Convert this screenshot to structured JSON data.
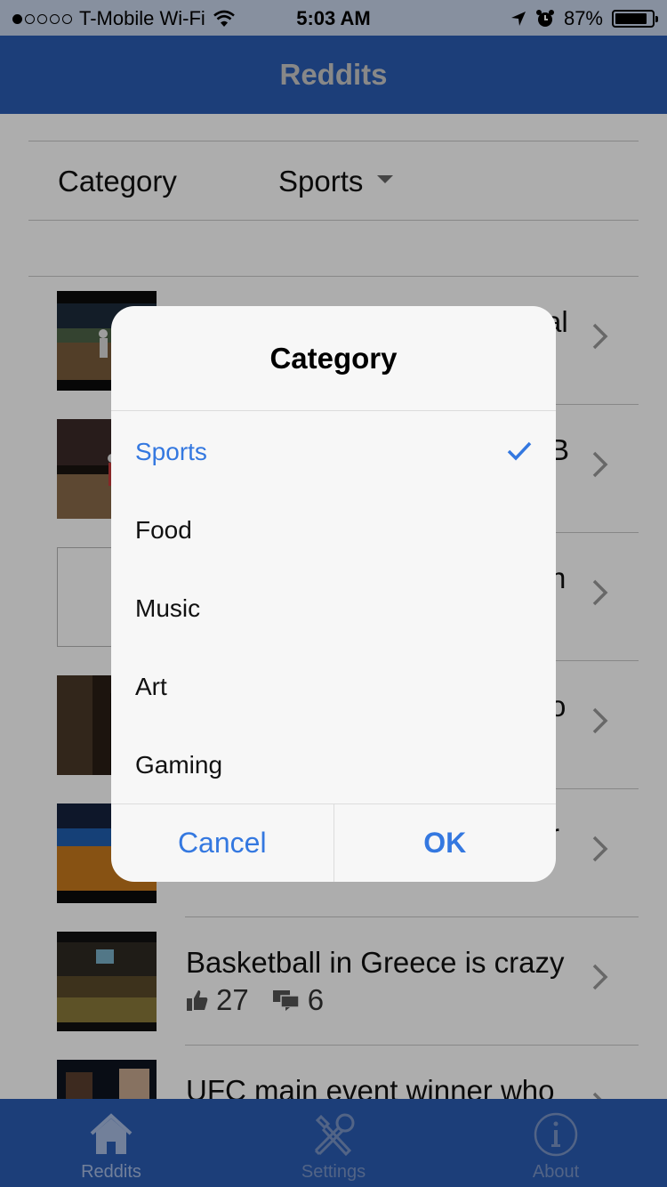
{
  "status_bar": {
    "carrier": "T-Mobile Wi-Fi",
    "time": "5:03 AM",
    "battery": "87%",
    "battery_level": 0.87,
    "signal_bars_filled": 1
  },
  "nav": {
    "title": "Reddits"
  },
  "filter": {
    "label": "Category",
    "value": "Sports"
  },
  "list": {
    "rows": [
      {
        "title": "",
        "likes": "",
        "comments": ""
      },
      {
        "title": "",
        "likes": "",
        "comments": ""
      },
      {
        "title": "",
        "likes": "",
        "comments": ""
      },
      {
        "title": "",
        "likes": "",
        "comments": ""
      },
      {
        "title": "",
        "likes": "",
        "comments": ""
      },
      {
        "title": "Basketball in Greece is crazy",
        "likes": "27",
        "comments": "6"
      },
      {
        "title": "UFC main event winner who",
        "likes": "",
        "comments": ""
      }
    ],
    "peek_fragments": [
      "al",
      "B",
      "h",
      "o",
      "r"
    ]
  },
  "dialog": {
    "title": "Category",
    "options": [
      "Sports",
      "Food",
      "Music",
      "Art",
      "Gaming"
    ],
    "selected": "Sports",
    "cancel_label": "Cancel",
    "ok_label": "OK"
  },
  "tab_bar": {
    "tabs": [
      {
        "label": "Reddits",
        "icon": "home-icon"
      },
      {
        "label": "Settings",
        "icon": "tools-icon"
      },
      {
        "label": "About",
        "icon": "info-icon"
      }
    ],
    "active": "Reddits"
  },
  "colors": {
    "nav_blue": "#2a5cb3",
    "accent": "#3478e0"
  }
}
